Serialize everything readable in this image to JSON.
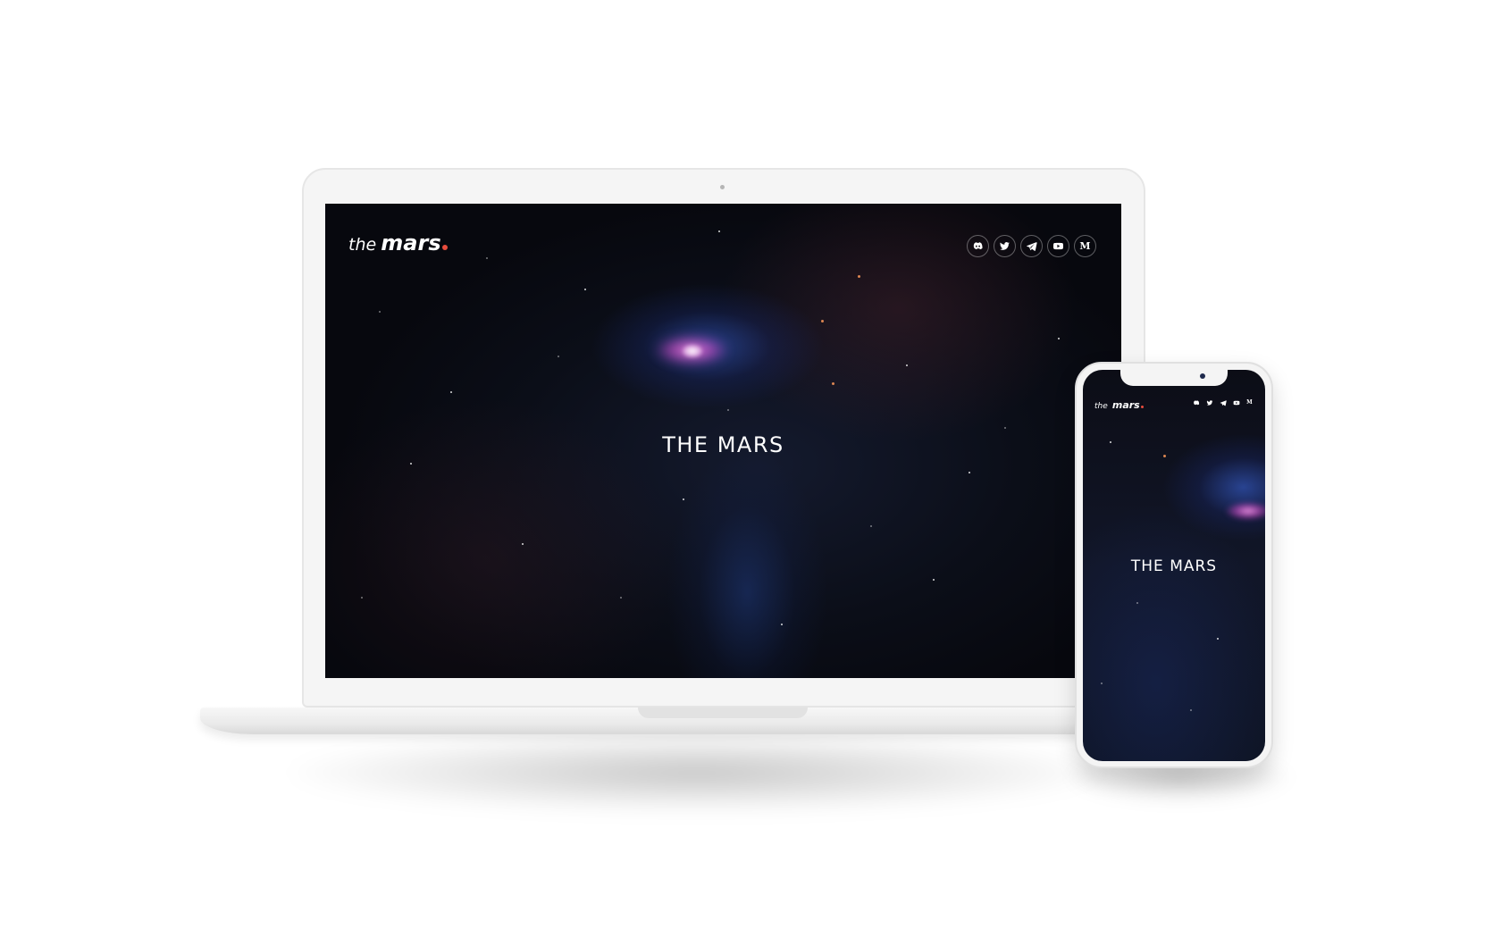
{
  "site": {
    "logo_the": "the",
    "logo_mars": "mars",
    "logo_dot_color": "#e84c3d",
    "hero_title": "THE MARS",
    "social_icons": [
      "discord-icon",
      "twitter-icon",
      "telegram-icon",
      "youtube-icon",
      "medium-icon"
    ],
    "medium_glyph": "M"
  },
  "colors": {
    "background": "#ffffff",
    "space_dark": "#0b0e18",
    "nebula_blue": "#3a64dc",
    "nebula_pink": "#c846be"
  }
}
